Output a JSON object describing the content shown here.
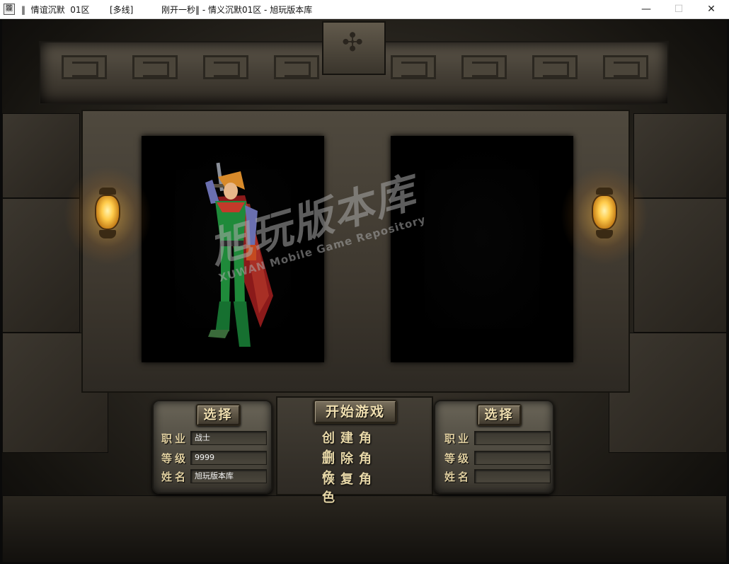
{
  "window": {
    "icon_text": "龖",
    "title_part1": "‖  情谊沉默  01区",
    "title_part2": "[多线]",
    "title_part3": "刚开一秒‖ - 情义沉默01区 - 旭玩版本库",
    "minimize_glyph": "—",
    "maximize_glyph": "☐",
    "close_glyph": "✕"
  },
  "watermark": {
    "main": "旭玩版本库",
    "sub": "XUWAN Mobile Game Repository"
  },
  "left_slot": {
    "select_label": "选择",
    "job_label": "职业",
    "job_value": "战士",
    "level_label": "等级",
    "level_value": "9999",
    "name_label": "姓名",
    "name_value": "旭玩版本库"
  },
  "right_slot": {
    "select_label": "选择",
    "job_label": "职业",
    "job_value": "",
    "level_label": "等级",
    "level_value": "",
    "name_label": "姓名",
    "name_value": ""
  },
  "center_menu": {
    "start_label": "开始游戏",
    "create_label": "创建角色",
    "delete_label": "删除角色",
    "restore_label": "恢复角色"
  }
}
